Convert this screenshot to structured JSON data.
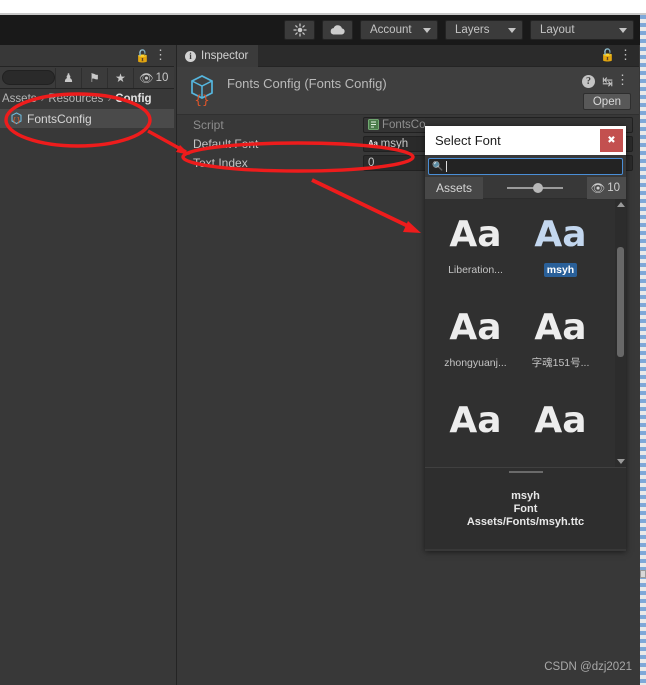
{
  "toolbar": {
    "light_icon": "sun-icon",
    "cloud_icon": "cloud-icon",
    "account_label": "Account",
    "layers_label": "Layers",
    "layout_label": "Layout"
  },
  "project_panel": {
    "search_placeholder": "",
    "visibility_count": "10",
    "breadcrumb": [
      "Assets",
      "Resources",
      "Config"
    ],
    "breadcrumb_separator": "›",
    "selected_asset": "FontsConfig"
  },
  "inspector": {
    "tab_label": "Inspector",
    "tab_icon": "info-icon",
    "object_title": "Fonts Config (Fonts Config)",
    "open_button": "Open",
    "properties": [
      {
        "label": "Script",
        "value": "FontsCo",
        "icon": "script-icon",
        "disabled": true
      },
      {
        "label": "Default Font",
        "value": "msyh",
        "icon": "font-aa-icon",
        "disabled": false
      },
      {
        "label": "Text Index",
        "value": "0",
        "icon": "",
        "disabled": false
      }
    ]
  },
  "modal": {
    "title": "Select Font",
    "close_label": "✖",
    "search_value": "",
    "assets_tab": "Assets",
    "visibility_count": "10",
    "fonts": [
      {
        "sample": "Aa",
        "label": "Liberation...",
        "selected": false
      },
      {
        "sample": "Aa",
        "label": "msyh",
        "selected": true
      },
      {
        "sample": "Aa",
        "label": "zhongyuanj...",
        "selected": false
      },
      {
        "sample": "Aa",
        "label": "字魂151号...",
        "selected": false
      },
      {
        "sample": "Aa",
        "label": "",
        "selected": false
      },
      {
        "sample": "Aa",
        "label": "",
        "selected": false
      }
    ],
    "info": {
      "name": "msyh",
      "type": "Font",
      "path": "Assets/Fonts/msyh.ttc"
    }
  },
  "watermark": "CSDN @dzj2021",
  "colors": {
    "accent_blue": "#2a6099",
    "annotation_red": "#ee1c1c",
    "panel_bg": "#383838",
    "toolbar_bg": "#191919",
    "close_red": "#c3504f"
  }
}
